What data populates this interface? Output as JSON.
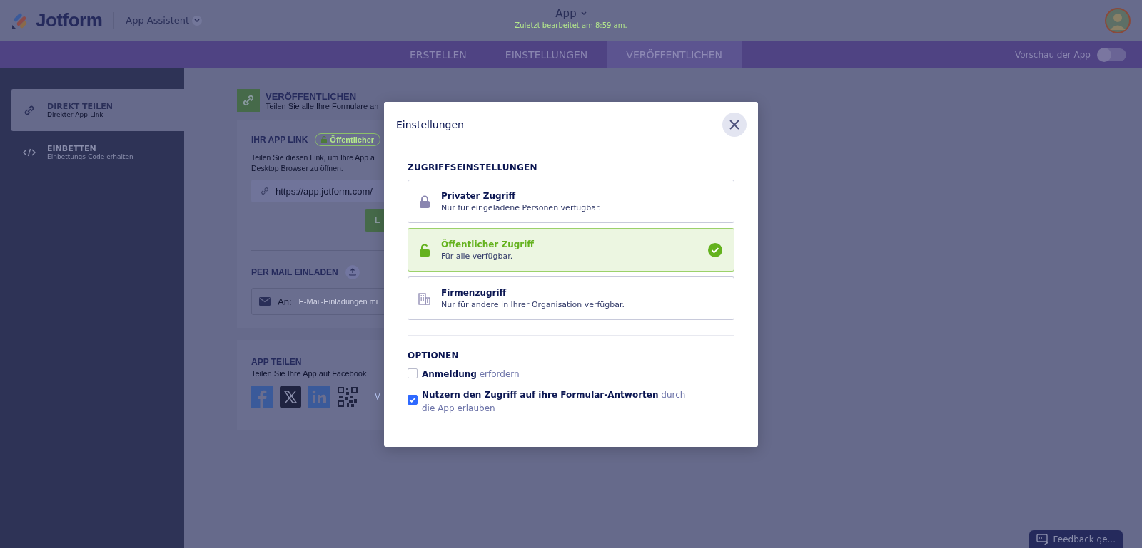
{
  "header": {
    "brand": "Jotform",
    "assistant": "App Assistent",
    "app_title": "App",
    "last_edited": "Zuletzt bearbeitet am 8:59 am."
  },
  "nav": {
    "tabs": [
      {
        "label": "ERSTELLEN",
        "selected": false
      },
      {
        "label": "EINSTELLUNGEN",
        "selected": false
      },
      {
        "label": "VERÖFFENTLICHEN",
        "selected": true
      }
    ],
    "preview": {
      "label": "Vorschau der App",
      "on": false
    }
  },
  "sidebar": {
    "items": [
      {
        "kind": "link",
        "title": "DIREKT TEILEN",
        "subtitle": "Direkter App-Link",
        "selected": true
      },
      {
        "kind": "code",
        "title": "EINBETTEN",
        "subtitle": "Einbettungs-Code erhalten",
        "selected": false
      }
    ]
  },
  "publish": {
    "title": "VERÖFFENTLICHEN",
    "subtitle": "Teilen Sie alle Ihre Formulare an",
    "link_card": {
      "title": "IHR APP LINK",
      "badge": "Öffentlicher",
      "description": [
        "Teilen Sie diesen Link, um Ihre App a",
        "Desktop Browser zu öffnen."
      ],
      "url": "https://app.jotform.com/",
      "button": "L"
    },
    "invite": {
      "title": "PER MAIL EINLADEN",
      "to_label": "An:",
      "placeholder": "E-Mail-Einladungen mi"
    },
    "share": {
      "title": "APP TEILEN",
      "subtitle": "Teilen Sie Ihre App auf Facebook",
      "link": "M"
    }
  },
  "modal": {
    "title": "Einstellungen",
    "access_heading": "ZUGRIFFSEINSTELLUNGEN",
    "access_options": [
      {
        "kind": "private",
        "title": "Privater Zugriff",
        "description": "Nur für eingeladene Personen verfügbar.",
        "selected": false
      },
      {
        "kind": "public",
        "title": "Öffentlicher Zugriff",
        "description": "Für alle verfügbar.",
        "selected": true
      },
      {
        "kind": "company",
        "title": "Firmenzugriff",
        "description": "Nur für andere in Ihrer Organisation verfügbar.",
        "selected": false
      }
    ],
    "options_heading": "OPTIONEN",
    "options": [
      {
        "label": "**Anmeldung** erfordern",
        "checked": false
      },
      {
        "label": "**Nutzern den Zugriff auf ihre Formular-Antworten** durch die App erlauben",
        "checked": true
      }
    ]
  },
  "feedback": "Feedback ge..."
}
